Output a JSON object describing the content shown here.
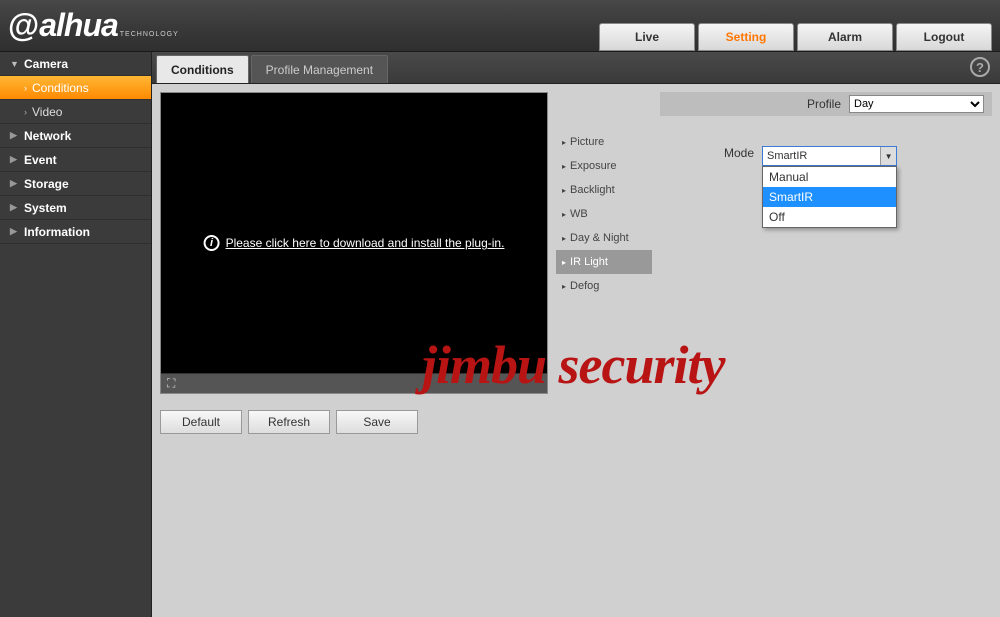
{
  "header": {
    "logo_main": "alhua",
    "logo_sub": "TECHNOLOGY",
    "nav": [
      "Live",
      "Setting",
      "Alarm",
      "Logout"
    ],
    "nav_active": "Setting"
  },
  "sidebar": {
    "items": [
      {
        "label": "Camera",
        "expanded": true,
        "children": [
          {
            "label": "Conditions",
            "active": true
          },
          {
            "label": "Video",
            "active": false
          }
        ]
      },
      {
        "label": "Network"
      },
      {
        "label": "Event"
      },
      {
        "label": "Storage"
      },
      {
        "label": "System"
      },
      {
        "label": "Information"
      }
    ]
  },
  "tabs": {
    "items": [
      "Conditions",
      "Profile Management"
    ],
    "active": "Conditions"
  },
  "help": "?",
  "video": {
    "plugin_text": "Please click here to download and install the plug-in."
  },
  "actions": {
    "default": "Default",
    "refresh": "Refresh",
    "save": "Save"
  },
  "options": {
    "items": [
      "Picture",
      "Exposure",
      "Backlight",
      "WB",
      "Day & Night",
      "IR Light",
      "Defog"
    ],
    "active": "IR Light"
  },
  "profile": {
    "label": "Profile",
    "selected": "Day"
  },
  "mode": {
    "label": "Mode",
    "selected": "SmartIR",
    "options": [
      "Manual",
      "SmartIR",
      "Off"
    ],
    "highlighted": "SmartIR"
  },
  "watermark": "jimbu security"
}
